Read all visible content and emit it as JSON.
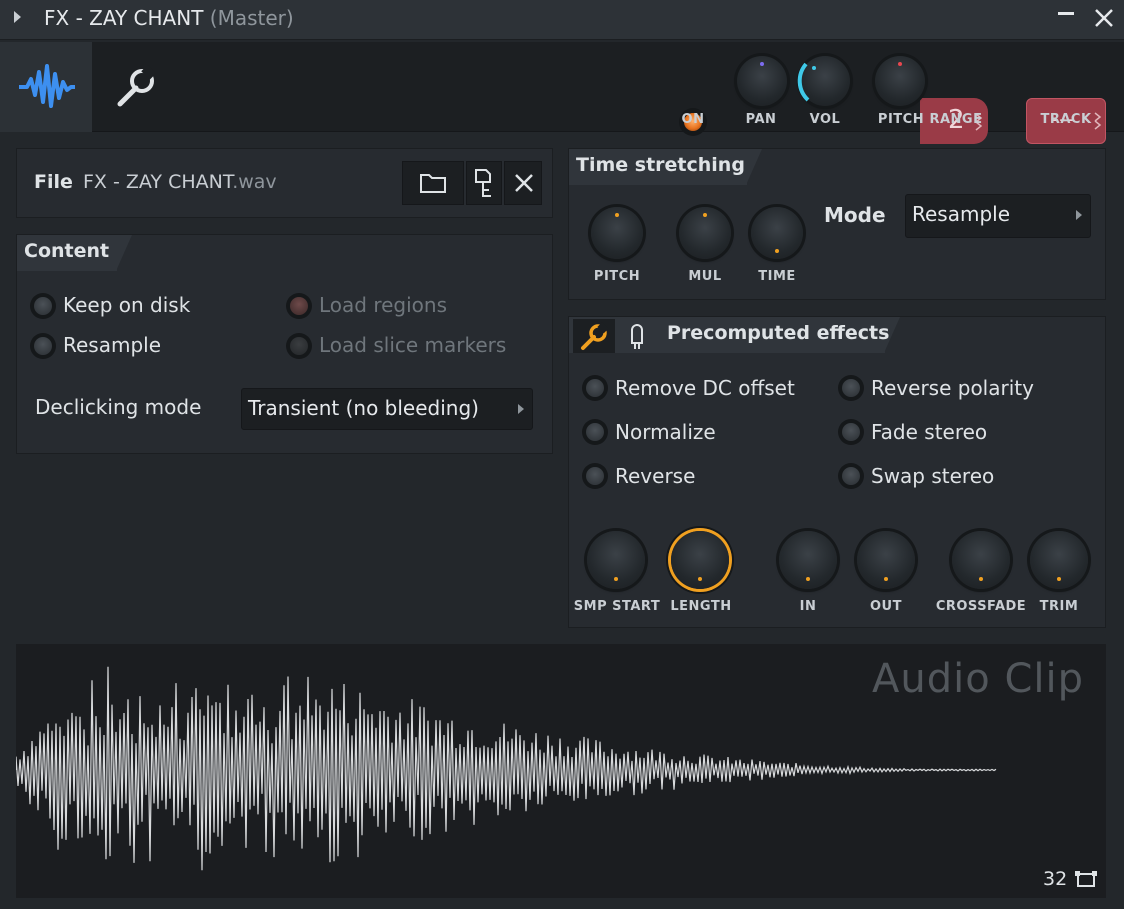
{
  "window": {
    "title": "FX - ZAY CHANT",
    "subtitle": "(Master)"
  },
  "header": {
    "on_label": "ON",
    "pan_label": "PAN",
    "vol_label": "VOL",
    "pitch_label": "PITCH",
    "range_label": "RANGE",
    "range_value": "2",
    "track_label": "TRACK",
    "track_value": "---"
  },
  "file": {
    "label": "File",
    "name": "FX - ZAY CHANT",
    "ext": ".wav"
  },
  "content": {
    "title": "Content",
    "options": [
      {
        "label": "Keep on disk",
        "enabled": true
      },
      {
        "label": "Resample",
        "enabled": true
      },
      {
        "label": "Load regions",
        "enabled": false
      },
      {
        "label": "Load slice markers",
        "enabled": false
      }
    ],
    "declicking_label": "Declicking mode",
    "declicking_value": "Transient (no bleeding)"
  },
  "time_stretching": {
    "title": "Time stretching",
    "knobs": [
      "PITCH",
      "MUL",
      "TIME"
    ],
    "mode_label": "Mode",
    "mode_value": "Resample"
  },
  "precomputed": {
    "title": "Precomputed effects",
    "options_left": [
      "Remove DC offset",
      "Normalize",
      "Reverse"
    ],
    "options_right": [
      "Reverse polarity",
      "Fade stereo",
      "Swap stereo"
    ],
    "knobs": [
      "SMP START",
      "LENGTH",
      "IN",
      "OUT",
      "CROSSFADE",
      "TRIM"
    ]
  },
  "waveform": {
    "label": "Audio Clip",
    "zoom": "32"
  },
  "colors": {
    "accent_blue": "#3d8ff0",
    "accent_orange": "#f0a020",
    "range_red": "#9a3b47"
  }
}
